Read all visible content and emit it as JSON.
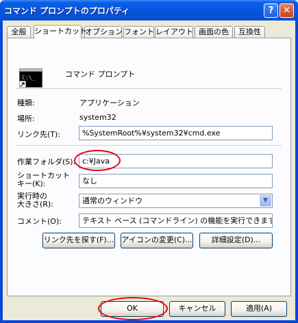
{
  "window": {
    "title": "コマンド プロンプトのプロパティ",
    "help_glyph": "?",
    "close_glyph": "✕"
  },
  "tabs": [
    {
      "label": "全般"
    },
    {
      "label": "ショートカット"
    },
    {
      "label": "オプション"
    },
    {
      "label": "フォント"
    },
    {
      "label": "レイアウト"
    },
    {
      "label": "画面の色"
    },
    {
      "label": "互換性"
    }
  ],
  "app": {
    "name": "コマンド プロンプト",
    "icon_text": "C:\\_"
  },
  "info": {
    "type_label": "種類:",
    "type_value": "アプリケーション",
    "location_label": "場所:",
    "location_value": "system32"
  },
  "fields": {
    "target_label": "リンク先(T):",
    "target_value": "%SystemRoot%¥system32¥cmd.exe",
    "startin_label": "作業フォルダ(S):",
    "startin_value": "c:¥Java",
    "shortcut_label_1": "ショートカット",
    "shortcut_label_2": "キー(K):",
    "shortcut_value": "なし",
    "run_label_1": "実行時の",
    "run_label_2": "大きさ(R):",
    "run_value": "通常のウィンドウ",
    "comment_label": "コメント(O):",
    "comment_value": "テキスト ベース (コマンドライン) の機能を実行できます。"
  },
  "buttons": {
    "find_target": "リンク先を探す(F)...",
    "change_icon": "アイコンの変更(C)...",
    "advanced": "詳細設定(D)...",
    "ok": "OK",
    "cancel": "キャンセル",
    "apply": "適用(A)"
  },
  "colors": {
    "title_bar": "#0653dc",
    "dialog_bg": "#ece9d8",
    "highlight_oval": "#e8000c"
  }
}
